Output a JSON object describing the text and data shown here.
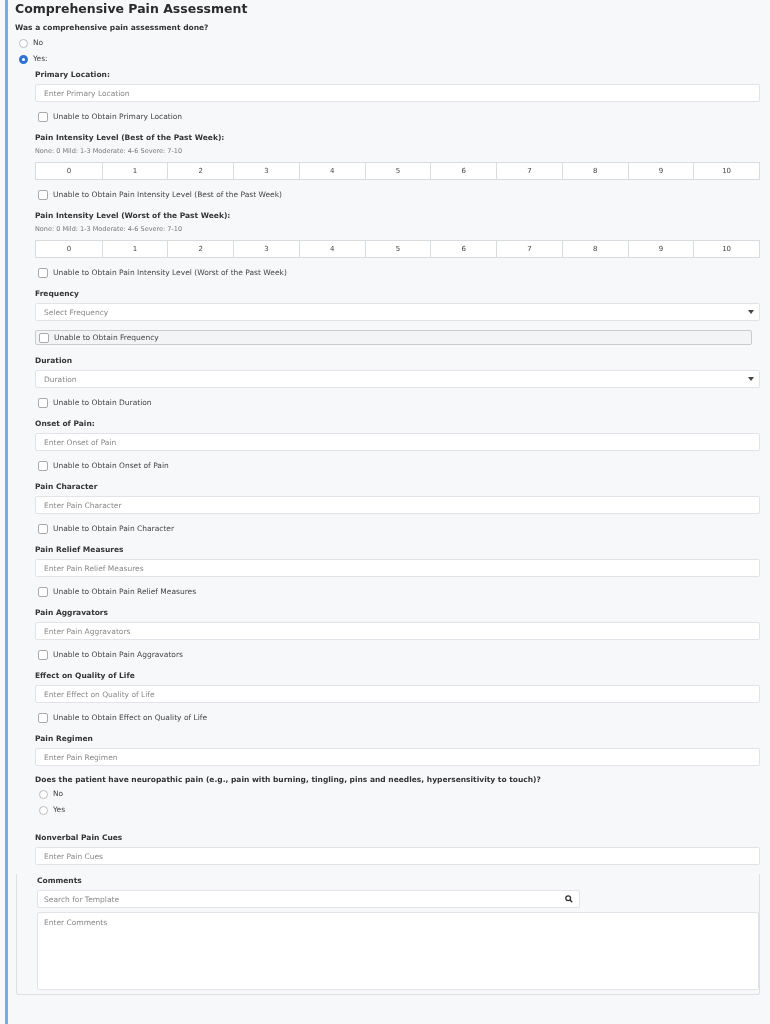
{
  "title": "Comprehensive Pain Assessment",
  "question": {
    "label": "Was a comprehensive pain assessment done?",
    "options": [
      {
        "label": "No",
        "selected": false
      },
      {
        "label": "Yes:",
        "selected": true
      }
    ]
  },
  "items": [
    {
      "kind": "text",
      "label": "Primary Location:",
      "placeholder": "Enter Primary Location"
    },
    {
      "kind": "checkbox",
      "label": "Unable to Obtain Primary Location",
      "checked": false
    },
    {
      "kind": "scale",
      "label": "Pain Intensity Level (Best of the Past Week):",
      "hint": "None: 0 Mild: 1-3 Moderate: 4-6 Severe: 7-10",
      "values": [
        {
          "label": "0",
          "selected": false
        },
        {
          "label": "1",
          "selected": false
        },
        {
          "label": "2",
          "selected": false
        },
        {
          "label": "3",
          "selected": false
        },
        {
          "label": "4",
          "selected": false
        },
        {
          "label": "5",
          "selected": false
        },
        {
          "label": "6",
          "selected": false
        },
        {
          "label": "7",
          "selected": false
        },
        {
          "label": "8",
          "selected": false
        },
        {
          "label": "9",
          "selected": false
        },
        {
          "label": "10",
          "selected": false
        }
      ]
    },
    {
      "kind": "checkbox",
      "label": "Unable to Obtain Pain Intensity Level (Best of the Past Week)",
      "checked": false
    },
    {
      "kind": "scale",
      "label": "Pain Intensity Level (Worst of the Past Week):",
      "hint": "None: 0 Mild: 1-3 Moderate: 4-6 Severe: 7-10",
      "values": [
        {
          "label": "0",
          "selected": false
        },
        {
          "label": "1",
          "selected": false
        },
        {
          "label": "2",
          "selected": false
        },
        {
          "label": "3",
          "selected": false
        },
        {
          "label": "4",
          "selected": false
        },
        {
          "label": "5",
          "selected": false
        },
        {
          "label": "6",
          "selected": false
        },
        {
          "label": "7",
          "selected": false
        },
        {
          "label": "8",
          "selected": false
        },
        {
          "label": "9",
          "selected": false
        },
        {
          "label": "10",
          "selected": false
        }
      ]
    },
    {
      "kind": "checkbox",
      "label": "Unable to Obtain Pain Intensity Level (Worst of the Past Week)",
      "checked": false
    },
    {
      "kind": "select",
      "label": "Frequency",
      "placeholder": "Select Frequency"
    },
    {
      "kind": "checkbox",
      "label": "Unable to Obtain Frequency",
      "checked": false,
      "focused": true
    },
    {
      "kind": "select",
      "label": "Duration",
      "placeholder": "Duration"
    },
    {
      "kind": "checkbox",
      "label": "Unable to Obtain Duration",
      "checked": false
    },
    {
      "kind": "text",
      "label": "Onset of Pain:",
      "placeholder": "Enter Onset of Pain"
    },
    {
      "kind": "checkbox",
      "label": "Unable to Obtain Onset of Pain",
      "checked": false
    },
    {
      "kind": "text",
      "label": "Pain Character",
      "placeholder": "Enter Pain Character"
    },
    {
      "kind": "checkbox",
      "label": "Unable to Obtain Pain Character",
      "checked": false
    },
    {
      "kind": "text",
      "label": "Pain Relief Measures",
      "placeholder": "Enter Pain Relief Measures"
    },
    {
      "kind": "checkbox",
      "label": "Unable to Obtain Pain Relief Measures",
      "checked": false
    },
    {
      "kind": "text",
      "label": "Pain Aggravators",
      "placeholder": "Enter Pain Aggravators"
    },
    {
      "kind": "checkbox",
      "label": "Unable to Obtain Pain Aggravators",
      "checked": false
    },
    {
      "kind": "text",
      "label": "Effect on Quality of Life",
      "placeholder": "Enter Effect on Quality of Life"
    },
    {
      "kind": "checkbox",
      "label": "Unable to Obtain Effect on Quality of Life",
      "checked": false
    },
    {
      "kind": "text",
      "label": "Pain Regimen",
      "placeholder": "Enter Pain Regimen"
    },
    {
      "kind": "radio",
      "label": "Does the patient have neuropathic pain (e.g., pain with burning, tingling, pins and needles, hypersensitivity to touch)?",
      "options": [
        {
          "label": "No",
          "selected": false
        },
        {
          "label": "Yes",
          "selected": false
        }
      ]
    },
    {
      "kind": "text",
      "label": "Nonverbal Pain Cues",
      "placeholder": "Enter Pain Cues"
    }
  ],
  "comments": {
    "label": "Comments",
    "search_placeholder": "Search for Template",
    "placeholder": "Enter Comments"
  }
}
